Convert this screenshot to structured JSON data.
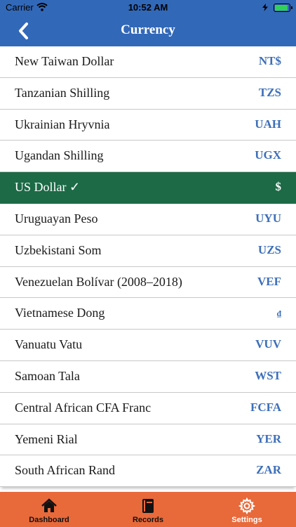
{
  "status_bar": {
    "carrier": "Carrier",
    "time": "10:52 AM"
  },
  "nav": {
    "title": "Currency",
    "back_icon": "chevron-left-icon"
  },
  "currencies": [
    {
      "name": "New Taiwan Dollar",
      "code": "NT$"
    },
    {
      "name": "Tanzanian Shilling",
      "code": "TZS"
    },
    {
      "name": "Ukrainian Hryvnia",
      "code": "UAH"
    },
    {
      "name": "Ugandan Shilling",
      "code": "UGX"
    },
    {
      "name": "US Dollar ✓",
      "code": "$"
    },
    {
      "name": "Uruguayan Peso",
      "code": "UYU"
    },
    {
      "name": "Uzbekistani Som",
      "code": "UZS"
    },
    {
      "name": "Venezuelan Bolívar (2008–2018)",
      "code": "VEF"
    },
    {
      "name": "Vietnamese Dong",
      "code": "₫"
    },
    {
      "name": "Vanuatu Vatu",
      "code": "VUV"
    },
    {
      "name": "Samoan Tala",
      "code": "WST"
    },
    {
      "name": "Central African CFA Franc",
      "code": "FCFA"
    },
    {
      "name": "Yemeni Rial",
      "code": "YER"
    },
    {
      "name": "South African Rand",
      "code": "ZAR"
    }
  ],
  "selected_index": 4,
  "tabs": [
    {
      "label": "Dashboard",
      "icon": "home-icon"
    },
    {
      "label": "Records",
      "icon": "book-icon"
    },
    {
      "label": "Settings",
      "icon": "gear-icon"
    }
  ],
  "colors": {
    "nav_blue": "#3268b8",
    "selected_green": "#1c6a46",
    "code_blue": "#3d6fb8",
    "tab_orange": "#e8693a"
  }
}
